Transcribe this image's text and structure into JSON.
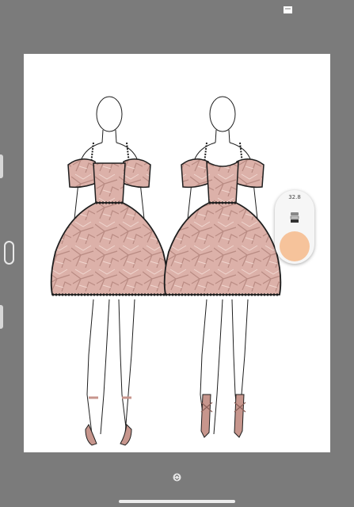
{
  "toolbar": {
    "brush_size": "32.8",
    "brush_icon": "brush-stack-icon",
    "current_color": "#f6c39b"
  },
  "icons": {
    "top_right": "window-icon",
    "bottom_center": "expand-collapse-icon"
  },
  "colors": {
    "background": "#7b7b7b",
    "canvas": "#ffffff",
    "fabric": "#dcb1a9",
    "fabric_shadow": "#b98b83",
    "outline": "#1e1e1e"
  }
}
